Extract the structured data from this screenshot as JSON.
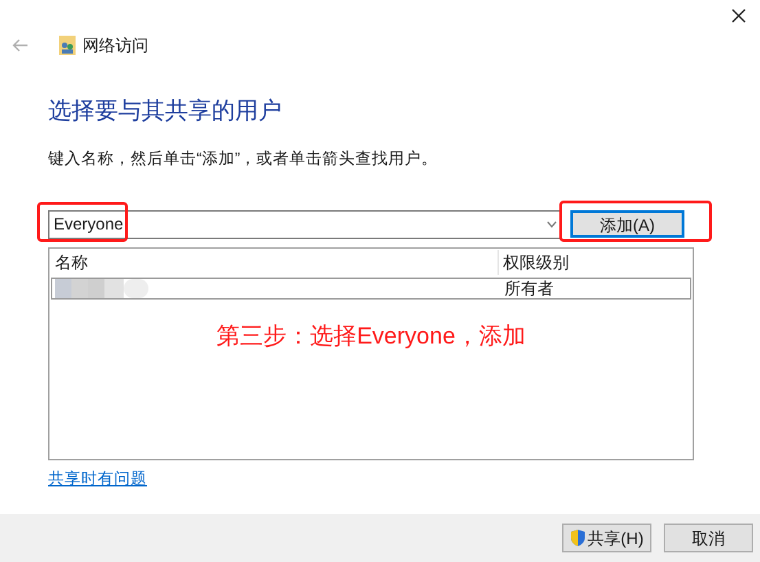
{
  "window": {
    "title": "网络访问"
  },
  "heading": "选择要与其共享的用户",
  "instruction": "键入名称，然后单击“添加”，或者单击箭头查找用户。",
  "name_field": {
    "value": "Everyone"
  },
  "add_button": "添加(A)",
  "table": {
    "columns": [
      "名称",
      "权限级别"
    ],
    "rows": [
      {
        "name_redacted": true,
        "permission": "所有者",
        "selected": true
      }
    ]
  },
  "annotation": "第三步：选择Everyone，添加",
  "help_link": "共享时有问题",
  "buttons": [
    {
      "label": "共享(H)",
      "shield": true
    },
    {
      "label": "取消",
      "shield": false
    }
  ]
}
